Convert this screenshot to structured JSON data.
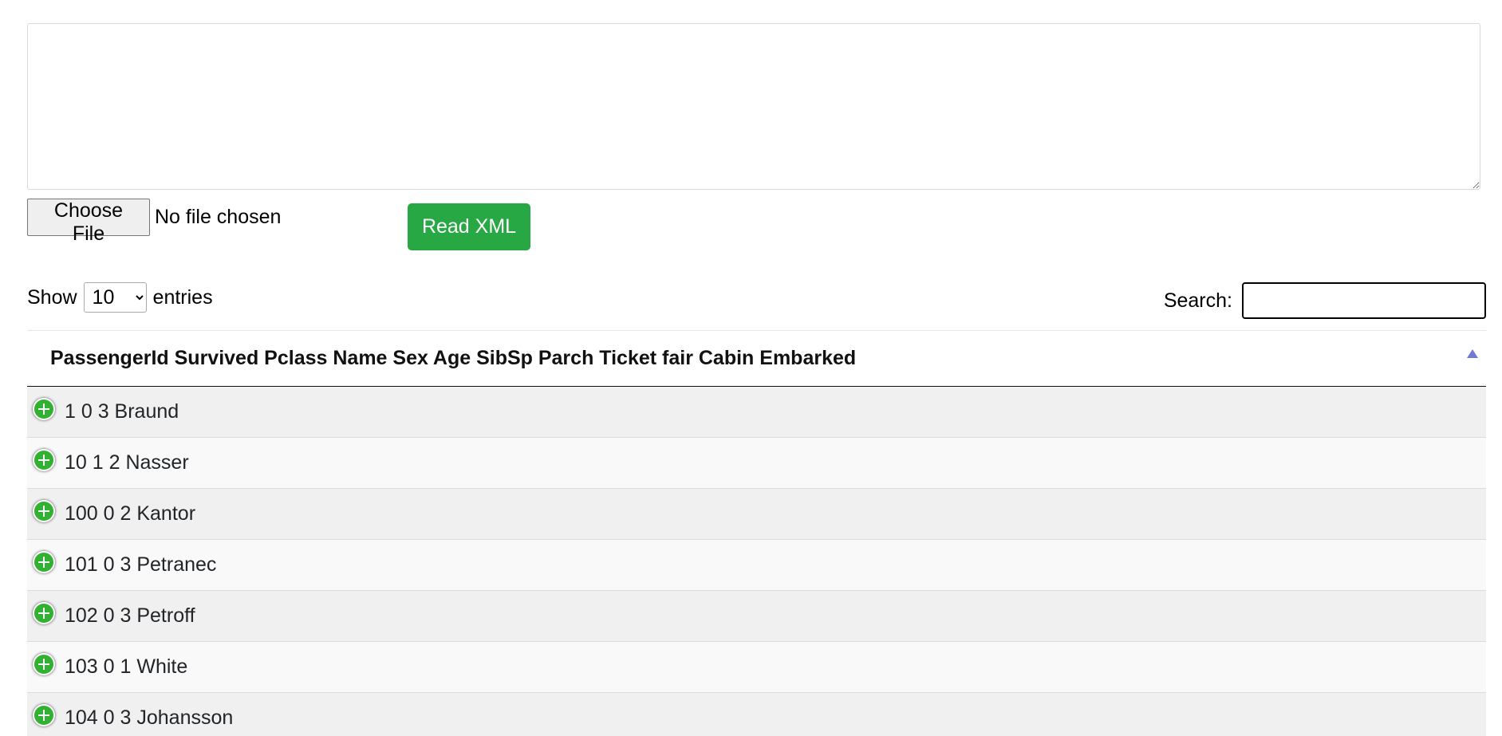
{
  "xml_input": {
    "value": ""
  },
  "file_picker": {
    "button_label": "Choose File",
    "status": "No file chosen"
  },
  "read_button": {
    "label": "Read XML",
    "color": "#28a745"
  },
  "length_control": {
    "prefix": "Show",
    "selected": "10",
    "suffix": "entries"
  },
  "search": {
    "label": "Search:",
    "value": ""
  },
  "table": {
    "header": "PassengerId Survived Pclass Name Sex Age SibSp Parch Ticket fair Cabin Embarked",
    "rows": [
      "1 0 3 Braund",
      "10 1 2 Nasser",
      "100 0 2 Kantor",
      "101 0 3 Petranec",
      "102 0 3 Petroff",
      "103 0 1 White",
      "104 0 3 Johansson"
    ]
  },
  "icons": {
    "expand": "plus-circle-icon",
    "sort": "sort-ascending-icon"
  },
  "colors": {
    "expand_icon": "#31b131",
    "sort_icon": "#6f79d8",
    "row_odd": "#f0f0f0",
    "row_even": "#f9f9f9"
  }
}
